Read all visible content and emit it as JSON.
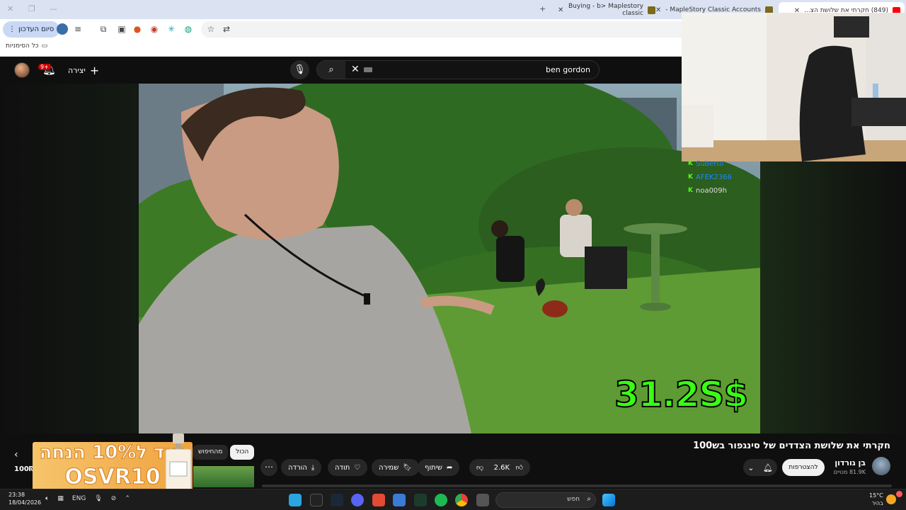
{
  "browser": {
    "tabs": [
      {
        "title": "(849) חקרתי את שלושת הצ...",
        "active": true,
        "icon": "youtube-icon"
      },
      {
        "title": "MapleStory Classic Accounts -",
        "active": false,
        "icon": "shield-icon"
      },
      {
        "title": "Buying - b> Maplestory classic",
        "active": false,
        "icon": "shield-icon"
      }
    ],
    "new_tab": "+",
    "end_session_label": "סיום העדכון",
    "bookmarks_all": "כל הסימניות"
  },
  "youtube": {
    "notifications_badge": "9+",
    "create_label": "יצירה",
    "search_query": "ben gordon",
    "video": {
      "overlay_price": "31.2S$"
    },
    "chat": [
      {
        "user": "Suberto"
      },
      {
        "user": "AFEK2366"
      },
      {
        "user": "noa009h"
      }
    ],
    "title": "חקרתי את שלושת הצדדים של סינגפור בש100",
    "channel_name": "בן גורדון",
    "subscribers": "81.9K מנויים",
    "join_label": "להצטרפות",
    "likes": "2.6K",
    "share_label": "שיתוף",
    "save_label": "שמירה",
    "thanks_label": "תודה",
    "download_label": "הורדה",
    "chips": [
      "הכול",
      "מהחיפוש"
    ],
    "side_price": "100₪",
    "ad": {
      "line1": "קוד ל10% הנחה",
      "line2": "OSVR10"
    }
  },
  "taskbar": {
    "time": "23:38",
    "date": "18/04/2026",
    "language": "ENG",
    "search_placeholder": "חפש",
    "weather_temp": "15°C",
    "weather_desc": "בהיר"
  },
  "colors": {
    "accent_green": "#39ff14",
    "yt_red": "#cc0000",
    "chrome_tab_bg": "#dbe3f3"
  }
}
